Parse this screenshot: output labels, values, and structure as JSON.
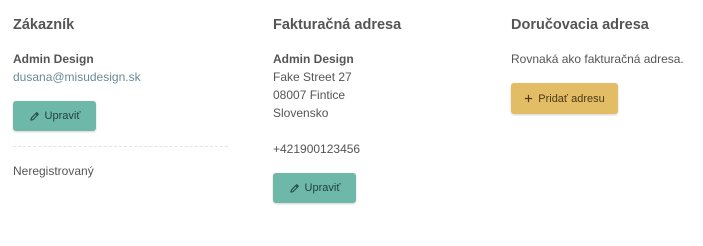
{
  "customer": {
    "title": "Zákazník",
    "name": "Admin Design",
    "email": "dusana@misudesign.sk",
    "edit_label": "Upraviť",
    "status": "Neregistrovaný"
  },
  "billing": {
    "title": "Fakturačná adresa",
    "name": "Admin Design",
    "street": "Fake Street 27",
    "city": "08007 Fintice",
    "country": "Slovensko",
    "phone": "+421900123456",
    "edit_label": "Upraviť"
  },
  "delivery": {
    "title": "Doručovacia adresa",
    "note": "Rovnaká ako fakturačná adresa.",
    "add_label": "Pridať adresu"
  },
  "colors": {
    "edit_button": "#6db8a9",
    "add_button": "#e3bc66",
    "link": "#6a8a96",
    "text": "#555555"
  },
  "icons": {
    "edit": "pencil-icon",
    "add": "plus-icon"
  }
}
